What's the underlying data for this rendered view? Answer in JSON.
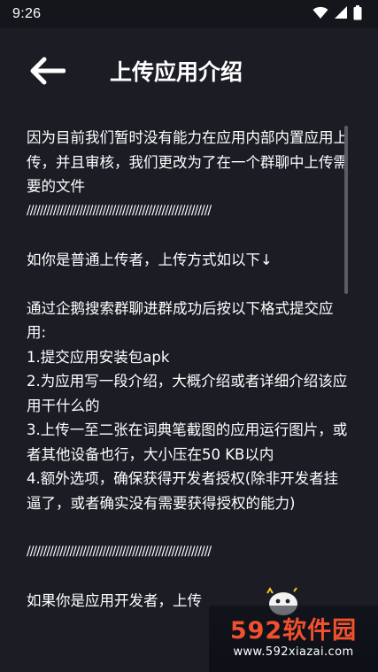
{
  "status_bar": {
    "time": "9:26",
    "icons": [
      "wifi-icon",
      "signal-icon",
      "battery-icon"
    ]
  },
  "toolbar": {
    "back_icon": "arrow-left-icon",
    "title": "上传应用介绍"
  },
  "content": {
    "p1": "因为目前我们暂时没有能力在应用内部内置应用上传，并且审核，我们更改为了在一个群聊中上传需要的文件",
    "slashes1": "////////////////////////////////////////////////////////",
    "p2": "如你是普通上传者，上传方式如以下↓",
    "p3": "通过企鹅搜索群聊进群成功后按以下格式提交应用:",
    "item1": "1.提交应用安装包apk",
    "item2": "2.为应用写一段介绍，大概介绍或者详细介绍该应用干什么的",
    "item3": "3.上传一至二张在词典笔截图的应用运行图片，或者其他设备也行，大小压在50 KB以内",
    "item4": "4.额外选项，确保获得开发者授权(除非开发者挂逼了，或者确实没有需要获得授权的能力)",
    "slashes2": "////////////////////////////////////////////////////////",
    "p4": "如果你是应用开发者，上传"
  },
  "watermark": {
    "logo_text": "592软件园",
    "url": "www.592xiazai.com"
  },
  "colors": {
    "background": "#1b1c24",
    "status_bar": "#15161c",
    "text": "#ffffff",
    "watermark_accent": "#f1512d"
  }
}
